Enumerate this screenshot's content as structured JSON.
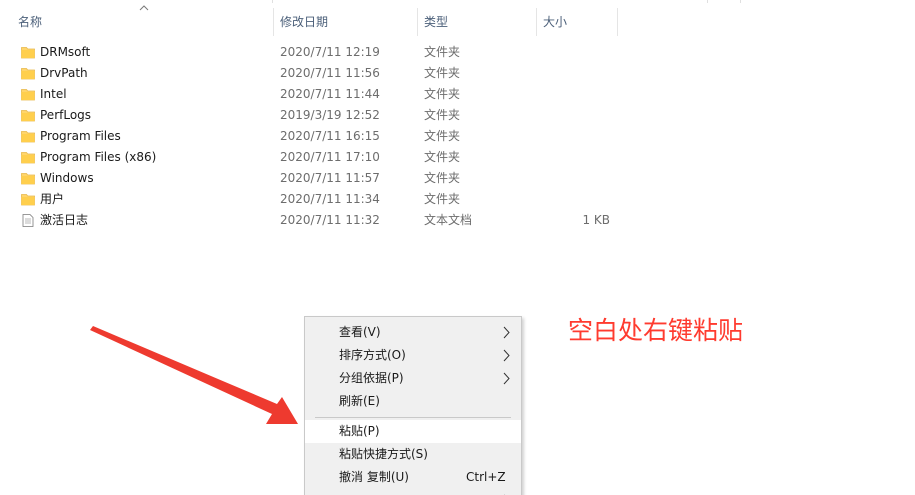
{
  "columns": {
    "name": "名称",
    "date": "修改日期",
    "type": "类型",
    "size": "大小"
  },
  "files": [
    {
      "name": "DRMsoft",
      "date": "2020/7/11 12:19",
      "type": "文件夹",
      "size": "",
      "icon": "folder-icon"
    },
    {
      "name": "DrvPath",
      "date": "2020/7/11 11:56",
      "type": "文件夹",
      "size": "",
      "icon": "folder-icon"
    },
    {
      "name": "Intel",
      "date": "2020/7/11 11:44",
      "type": "文件夹",
      "size": "",
      "icon": "folder-icon"
    },
    {
      "name": "PerfLogs",
      "date": "2019/3/19 12:52",
      "type": "文件夹",
      "size": "",
      "icon": "folder-icon"
    },
    {
      "name": "Program Files",
      "date": "2020/7/11 16:15",
      "type": "文件夹",
      "size": "",
      "icon": "folder-icon"
    },
    {
      "name": "Program Files (x86)",
      "date": "2020/7/11 17:10",
      "type": "文件夹",
      "size": "",
      "icon": "folder-icon"
    },
    {
      "name": "Windows",
      "date": "2020/7/11 11:57",
      "type": "文件夹",
      "size": "",
      "icon": "folder-icon"
    },
    {
      "name": "用户",
      "date": "2020/7/11 11:34",
      "type": "文件夹",
      "size": "",
      "icon": "folder-icon"
    },
    {
      "name": "激活日志",
      "date": "2020/7/11 11:32",
      "type": "文本文档",
      "size": "1 KB",
      "icon": "text-document-icon"
    }
  ],
  "context_menu": {
    "items": [
      {
        "label": "查看(V)",
        "submenu": true
      },
      {
        "label": "排序方式(O)",
        "submenu": true
      },
      {
        "label": "分组依据(P)",
        "submenu": true
      },
      {
        "label": "刷新(E)",
        "submenu": false
      },
      {
        "label": "粘贴(P)",
        "submenu": false,
        "highlighted": true
      },
      {
        "label": "粘贴快捷方式(S)",
        "submenu": false
      },
      {
        "label": "撤消 复制(U)",
        "shortcut": "Ctrl+Z",
        "submenu": false
      }
    ]
  },
  "annotation": {
    "text": "空白处右键粘贴",
    "color": "#ff3b2f"
  },
  "colors": {
    "folder": "#ffd56b",
    "header_text": "#4c607a",
    "menu_bg": "#f0f0f0",
    "arrow": "#ee3a2f"
  }
}
